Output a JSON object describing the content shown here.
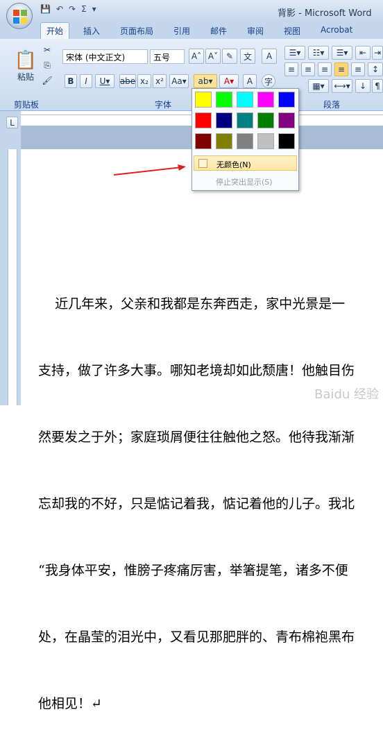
{
  "window": {
    "title": "背影 - Microsoft Word"
  },
  "tabs": [
    "开始",
    "插入",
    "页面布局",
    "引用",
    "邮件",
    "审阅",
    "视图",
    "Acrobat"
  ],
  "ribbon": {
    "paste_label": "粘贴",
    "clipboard_label": "剪贴板",
    "font_label": "字体",
    "paragraph_label": "段落",
    "font_name": "宋体 (中文正文)",
    "font_size": "五号"
  },
  "highlight_menu": {
    "colors": [
      [
        "#ffff00",
        "#00ff00",
        "#00ffff",
        "#ff00ff",
        "#0000ff"
      ],
      [
        "#ff0000",
        "#000080",
        "#008080",
        "#008000",
        "#800080"
      ],
      [
        "#800000",
        "#808000",
        "#808080",
        "#c0c0c0",
        "#000000"
      ]
    ],
    "no_color": "无颜色(N)",
    "stop": "停止突出显示(S)"
  },
  "document": {
    "lines": [
      "    近几年来，父亲和我都是东奔西走，家中光景是一",
      "支持，做了许多大事。哪知老境却如此颓唐！他触目伤",
      "然要发之于外；家庭琐屑便往往触他之怒。他待我渐渐",
      "忘却我的不好，只是惦记着我，惦记着他的儿子。我北",
      "“我身体平安，惟膀子疼痛厉害，举箸提笔，诸多不便",
      "处，在晶莹的泪光中，又看见那肥胖的、青布棉袍黑布",
      "他相见！↵"
    ]
  },
  "watermark": "Baidu 经验"
}
